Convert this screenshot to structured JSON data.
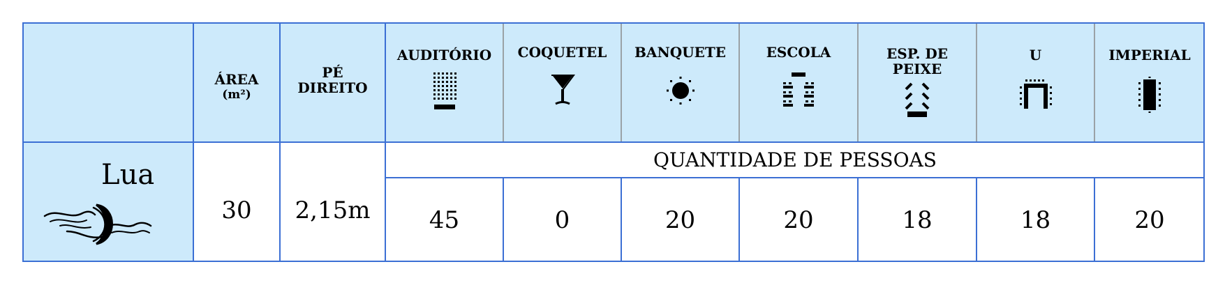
{
  "header": {
    "area_label": "ÁREA",
    "area_unit": "(m²)",
    "height_label_1": "PÉ",
    "height_label_2": "DIREITO",
    "layouts": [
      {
        "label": "AUDITÓRIO",
        "icon": "auditorium-layout-icon"
      },
      {
        "label": "COQUETEL",
        "icon": "cocktail-glass-icon"
      },
      {
        "label": "BANQUETE",
        "icon": "banquet-round-table-icon"
      },
      {
        "label": "ESCOLA",
        "icon": "classroom-layout-icon"
      },
      {
        "label": "ESP. DE PEIXE",
        "icon": "herringbone-layout-icon"
      },
      {
        "label": "U",
        "icon": "u-shape-layout-icon"
      },
      {
        "label": "IMPERIAL",
        "icon": "imperial-table-icon"
      }
    ]
  },
  "room": {
    "name": "Lua",
    "logo": "moon-waves-icon",
    "area": "30",
    "height": "2,15m",
    "quantity_label": "QUANTIDADE DE PESSOAS",
    "capacities": [
      "45",
      "0",
      "20",
      "20",
      "18",
      "18",
      "20"
    ]
  },
  "colors": {
    "header_bg": "#cdeafb",
    "border": "#3b6fd4",
    "inner_line": "#8a8a8a"
  }
}
